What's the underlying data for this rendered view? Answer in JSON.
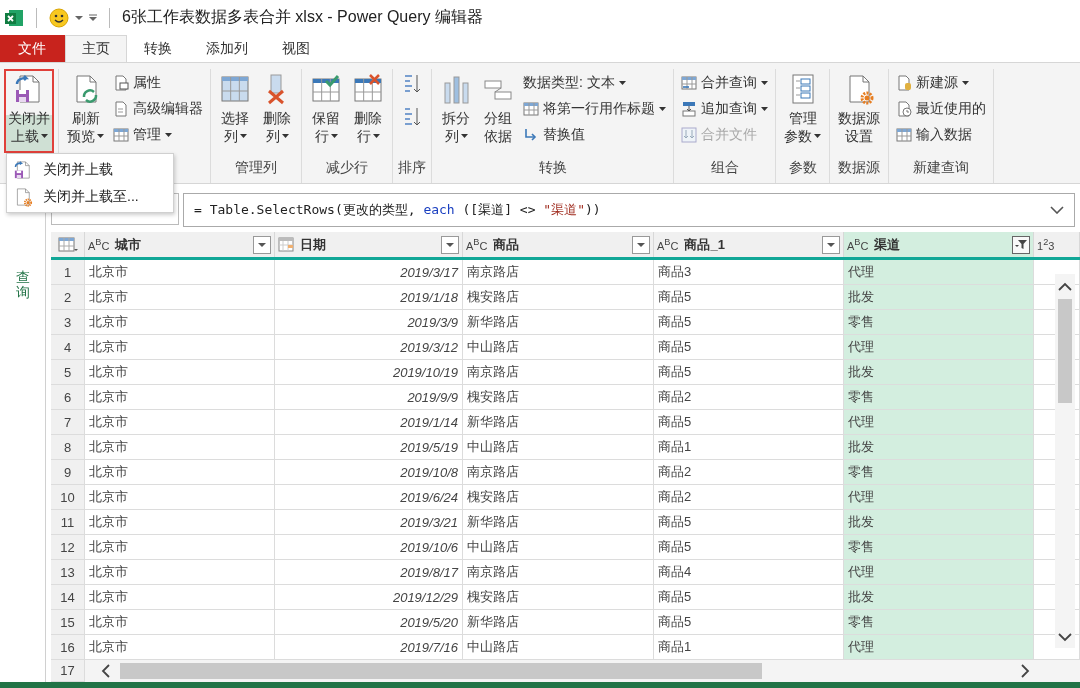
{
  "window": {
    "title": "6张工作表数据多表合并 xlsx - Power Query 编辑器"
  },
  "tabs": [
    {
      "label": "文件",
      "kind": "file",
      "selected": false
    },
    {
      "label": "主页",
      "kind": "tab",
      "selected": true
    },
    {
      "label": "转换",
      "kind": "tab",
      "selected": false
    },
    {
      "label": "添加列",
      "kind": "tab",
      "selected": false
    },
    {
      "label": "视图",
      "kind": "tab",
      "selected": false
    }
  ],
  "ribbon": {
    "groups": [
      {
        "items": [
          {
            "kind": "large",
            "lines": [
              "关闭并",
              "上载"
            ],
            "dropdown": true,
            "highlighted": true
          }
        ]
      },
      {
        "items": [
          {
            "kind": "large",
            "lines": [
              "刷新",
              "预览"
            ],
            "dropdown": true,
            "highlighted": false
          },
          {
            "kind": "stack",
            "items": [
              {
                "label": "属性",
                "dropdown": false,
                "disabled": false
              },
              {
                "label": "高级编辑器",
                "dropdown": false,
                "disabled": false
              },
              {
                "label": "管理",
                "dropdown": true,
                "disabled": false
              }
            ]
          }
        ]
      },
      {
        "label": "管理列",
        "items": [
          {
            "kind": "large",
            "lines": [
              "选择",
              "列"
            ],
            "dropdown": true,
            "highlighted": false
          },
          {
            "kind": "large",
            "lines": [
              "删除",
              "列"
            ],
            "dropdown": true,
            "highlighted": false
          }
        ]
      },
      {
        "label": "减少行",
        "items": [
          {
            "kind": "large",
            "lines": [
              "保留",
              "行"
            ],
            "dropdown": true,
            "highlighted": false
          },
          {
            "kind": "large",
            "lines": [
              "删除",
              "行"
            ],
            "dropdown": true,
            "highlighted": false
          }
        ]
      },
      {
        "label": "排序",
        "items": [
          {
            "kind": "sort"
          }
        ]
      },
      {
        "label": "转换",
        "items": [
          {
            "kind": "large",
            "lines": [
              "拆分",
              "列"
            ],
            "dropdown": true,
            "highlighted": false
          },
          {
            "kind": "large",
            "lines": [
              "分组",
              "依据"
            ],
            "dropdown": false,
            "highlighted": false
          },
          {
            "kind": "stack",
            "items": [
              {
                "label": "数据类型: 文本",
                "dropdown": true,
                "disabled": false
              },
              {
                "label": "将第一行用作标题",
                "dropdown": true,
                "disabled": false
              },
              {
                "label": "替换值",
                "dropdown": false,
                "disabled": false
              }
            ]
          }
        ]
      },
      {
        "label": "组合",
        "items": [
          {
            "kind": "stack",
            "items": [
              {
                "label": "合并查询",
                "dropdown": true,
                "disabled": false
              },
              {
                "label": "追加查询",
                "dropdown": true,
                "disabled": false
              },
              {
                "label": "合并文件",
                "dropdown": false,
                "disabled": true
              }
            ]
          }
        ]
      },
      {
        "label": "参数",
        "items": [
          {
            "kind": "large",
            "lines": [
              "管理",
              "参数"
            ],
            "dropdown": true,
            "highlighted": false
          }
        ]
      },
      {
        "label": "数据源",
        "items": [
          {
            "kind": "large",
            "lines": [
              "数据源",
              "设置"
            ],
            "dropdown": false,
            "highlighted": false
          }
        ]
      },
      {
        "label": "新建查询",
        "items": [
          {
            "kind": "stack",
            "items": [
              {
                "label": "新建源",
                "dropdown": true,
                "disabled": false
              },
              {
                "label": "最近使用的",
                "dropdown": false,
                "disabled": false
              },
              {
                "label": "输入数据",
                "dropdown": false,
                "disabled": false
              }
            ]
          }
        ]
      }
    ]
  },
  "menu": {
    "items": [
      "关闭并上载",
      "关闭并上载至..."
    ]
  },
  "queries_pane": {
    "label": "查询"
  },
  "formula": {
    "segments": [
      {
        "text": "= Table.SelectRows(更改的类型, ",
        "kind": "plain"
      },
      {
        "text": "each",
        "kind": "keyword"
      },
      {
        "text": " ([渠道] <> ",
        "kind": "plain"
      },
      {
        "text": "\"渠道\"",
        "kind": "string"
      },
      {
        "text": "))",
        "kind": "plain"
      }
    ]
  },
  "table": {
    "columns": [
      {
        "name": "城市",
        "kind": "text",
        "type_label": "A$^{B}$C",
        "selected": false,
        "filtered": false
      },
      {
        "name": "日期",
        "kind": "date",
        "selected": false,
        "filtered": false
      },
      {
        "name": "商品",
        "kind": "text",
        "type_label": "A$^{B}$C",
        "selected": false,
        "filtered": false
      },
      {
        "name": "商品_1",
        "kind": "text",
        "type_label": "A$^{B}$C",
        "selected": false,
        "filtered": false
      },
      {
        "name": "渠道",
        "kind": "text",
        "type_label": "A$^{B}$C",
        "selected": true,
        "filtered": true
      },
      {
        "kind": "number",
        "type_label": "1$^{2}$3",
        "selected": false
      }
    ],
    "rows": [
      {
        "n": "1",
        "cells": [
          "北京市",
          "2019/3/17",
          "南京路店",
          "商品3",
          "代理"
        ]
      },
      {
        "n": "2",
        "cells": [
          "北京市",
          "2019/1/18",
          "槐安路店",
          "商品5",
          "批发"
        ]
      },
      {
        "n": "3",
        "cells": [
          "北京市",
          "2019/3/9",
          "新华路店",
          "商品5",
          "零售"
        ]
      },
      {
        "n": "4",
        "cells": [
          "北京市",
          "2019/3/12",
          "中山路店",
          "商品5",
          "代理"
        ]
      },
      {
        "n": "5",
        "cells": [
          "北京市",
          "2019/10/19",
          "南京路店",
          "商品5",
          "批发"
        ]
      },
      {
        "n": "6",
        "cells": [
          "北京市",
          "2019/9/9",
          "槐安路店",
          "商品2",
          "零售"
        ]
      },
      {
        "n": "7",
        "cells": [
          "北京市",
          "2019/1/14",
          "新华路店",
          "商品5",
          "代理"
        ]
      },
      {
        "n": "8",
        "cells": [
          "北京市",
          "2019/5/19",
          "中山路店",
          "商品1",
          "批发"
        ]
      },
      {
        "n": "9",
        "cells": [
          "北京市",
          "2019/10/8",
          "南京路店",
          "商品2",
          "零售"
        ]
      },
      {
        "n": "10",
        "cells": [
          "北京市",
          "2019/6/24",
          "槐安路店",
          "商品2",
          "代理"
        ]
      },
      {
        "n": "11",
        "cells": [
          "北京市",
          "2019/3/21",
          "新华路店",
          "商品5",
          "批发"
        ]
      },
      {
        "n": "12",
        "cells": [
          "北京市",
          "2019/10/6",
          "中山路店",
          "商品5",
          "零售"
        ]
      },
      {
        "n": "13",
        "cells": [
          "北京市",
          "2019/8/17",
          "南京路店",
          "商品4",
          "代理"
        ]
      },
      {
        "n": "14",
        "cells": [
          "北京市",
          "2019/12/29",
          "槐安路店",
          "商品5",
          "批发"
        ]
      },
      {
        "n": "15",
        "cells": [
          "北京市",
          "2019/5/20",
          "新华路店",
          "商品5",
          "零售"
        ]
      },
      {
        "n": "16",
        "cells": [
          "北京市",
          "2019/7/16",
          "中山路店",
          "商品1",
          "代理"
        ]
      }
    ],
    "last_row_number": "17"
  }
}
